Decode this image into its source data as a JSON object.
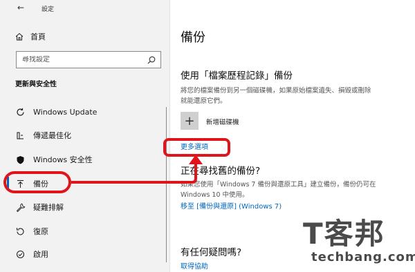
{
  "window": {
    "title": "設定",
    "back_icon": "back-arrow-icon"
  },
  "sidebar": {
    "home_label": "首頁",
    "search_placeholder": "尋找設定",
    "section_title": "更新與安全性",
    "items": [
      {
        "label": "Windows Update",
        "icon": "refresh-icon"
      },
      {
        "label": "傳遞最佳化",
        "icon": "delivery-optimization-icon"
      },
      {
        "label": "Windows 安全性",
        "icon": "shield-icon"
      },
      {
        "label": "備份",
        "icon": "backup-arrow-icon",
        "active": true
      },
      {
        "label": "疑難排解",
        "icon": "wrench-icon"
      },
      {
        "label": "復原",
        "icon": "recovery-icon"
      },
      {
        "label": "啟用",
        "icon": "activation-icon"
      }
    ]
  },
  "main": {
    "title": "備份",
    "file_history": {
      "heading": "使用「檔案歷程記錄」備份",
      "description_line1": "將您的檔案備份到另一個磁碟機，如果原始檔案遺失、損毀或刪除",
      "description_line2": "就能還原它們。",
      "add_drive_label": "新增磁碟機",
      "more_options_link": "更多選項"
    },
    "older_backup": {
      "heading": "正在尋找舊的備份?",
      "description_line1": "如果您使用「Windows 7 備份與還原工具」建立備份，備份仍可在",
      "description_line2": "Windows 10 中使用。",
      "link": "移至 [備份與還原] (Windows 7)"
    },
    "help": {
      "heading": "有任何疑問嗎?",
      "link": "取得協助"
    }
  },
  "annotations": {
    "highlight_color": "#e0141b"
  },
  "watermark": {
    "glyphs": "T客邦",
    "text": "techbang.com"
  }
}
